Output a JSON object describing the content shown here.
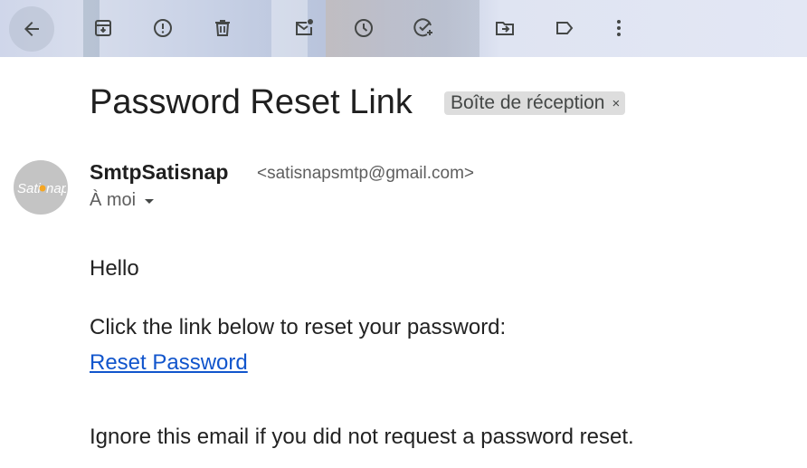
{
  "toolbar": {
    "buttons": [
      {
        "name": "back-button",
        "icon": "arrow-left-icon"
      },
      {
        "name": "archive-button",
        "icon": "archive-icon"
      },
      {
        "name": "report-spam-button",
        "icon": "report-icon"
      },
      {
        "name": "delete-button",
        "icon": "trash-icon"
      },
      {
        "name": "mark-unread-button",
        "icon": "mark-unread-icon"
      },
      {
        "name": "snooze-button",
        "icon": "clock-icon"
      },
      {
        "name": "add-task-button",
        "icon": "add-task-icon"
      },
      {
        "name": "move-to-button",
        "icon": "move-to-icon"
      },
      {
        "name": "labels-button",
        "icon": "label-icon"
      },
      {
        "name": "more-button",
        "icon": "more-vert-icon"
      }
    ]
  },
  "email": {
    "subject": "Password Reset Link",
    "label": "Boîte de réception",
    "label_remove": "×",
    "sender": {
      "name": "SmtpSatisnap",
      "email": "<satisnapsmtp@gmail.com>",
      "avatar_text": "Satisnap"
    },
    "recipient": "À moi",
    "body": {
      "greeting": "Hello",
      "instruction": "Click the link below to reset your password:",
      "link_text": "Reset Password",
      "ignore_note": "Ignore this email if you did not request a password reset."
    }
  },
  "colors": {
    "link": "#1155cc",
    "chip_bg": "#dddddd",
    "avatar_bg": "#c4c4c4",
    "avatar_accent": "#f5a623"
  }
}
